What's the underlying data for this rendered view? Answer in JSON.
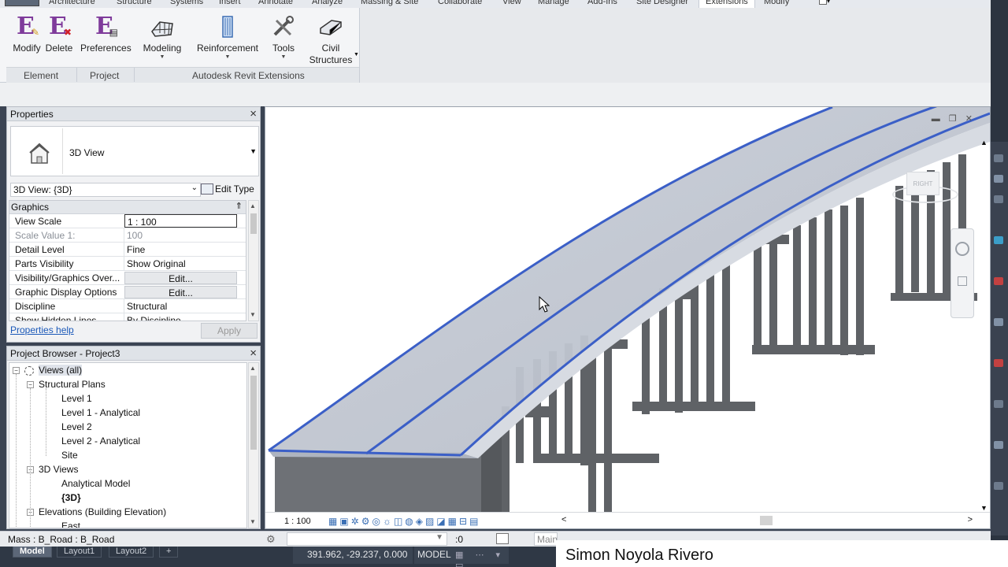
{
  "ribbon": {
    "tabs": [
      "Architecture",
      "Structure",
      "Systems",
      "Insert",
      "Annotate",
      "Analyze",
      "Massing & Site",
      "Collaborate",
      "View",
      "Manage",
      "Add-Ins",
      "Site Designer",
      "Extensions",
      "Modify"
    ],
    "active_tab": "Extensions",
    "buttons": {
      "modify": "Modify",
      "delete": "Delete",
      "preferences": "Preferences",
      "modeling": "Modeling",
      "reinforcement": "Reinforcement",
      "tools": "Tools",
      "civil_line1": "Civil",
      "civil_line2": "Structures"
    },
    "panels": {
      "element": "Element",
      "project": "Project",
      "extensions": "Autodesk Revit Extensions"
    },
    "accent_color": "#7f3b9b"
  },
  "properties": {
    "title": "Properties",
    "type_name": "3D View",
    "instance_selector": "3D View: {3D}",
    "edit_type": "Edit Type",
    "group": "Graphics",
    "rows": [
      {
        "key": "View Scale",
        "value": "1 : 100"
      },
      {
        "key": "Scale Value    1:",
        "value": "100"
      },
      {
        "key": "Detail Level",
        "value": "Fine"
      },
      {
        "key": "Parts Visibility",
        "value": "Show Original"
      },
      {
        "key": "Visibility/Graphics Over...",
        "value": "Edit..."
      },
      {
        "key": "Graphic Display Options",
        "value": "Edit..."
      },
      {
        "key": "Discipline",
        "value": "Structural"
      },
      {
        "key": "Show Hidden Lines",
        "value": "By Discipline"
      }
    ],
    "help_link": "Properties help",
    "apply": "Apply"
  },
  "browser": {
    "title": "Project Browser - Project3",
    "nodes": [
      {
        "label": "Views (all)"
      },
      {
        "label": "Structural Plans"
      },
      {
        "label": "Level 1"
      },
      {
        "label": "Level 1 - Analytical"
      },
      {
        "label": "Level 2"
      },
      {
        "label": "Level 2 - Analytical"
      },
      {
        "label": "Site"
      },
      {
        "label": "3D Views"
      },
      {
        "label": "Analytical Model"
      },
      {
        "label": "{3D}"
      },
      {
        "label": "Elevations (Building Elevation)"
      },
      {
        "label": "East"
      }
    ]
  },
  "viewport": {
    "scale": "1 : 100",
    "viewcube_label": "RIGHT"
  },
  "status": {
    "message": "Mass : B_Road : B_Road",
    "selection_count": ":0",
    "main_model": "Main Model"
  },
  "bottom": {
    "layout_tabs": [
      "Model",
      "Layout1",
      "Layout2",
      "+"
    ],
    "coordinates": "391.962, -29.237, 0.000",
    "space": "MODEL"
  },
  "watermark": "Simon Noyola Rivero"
}
